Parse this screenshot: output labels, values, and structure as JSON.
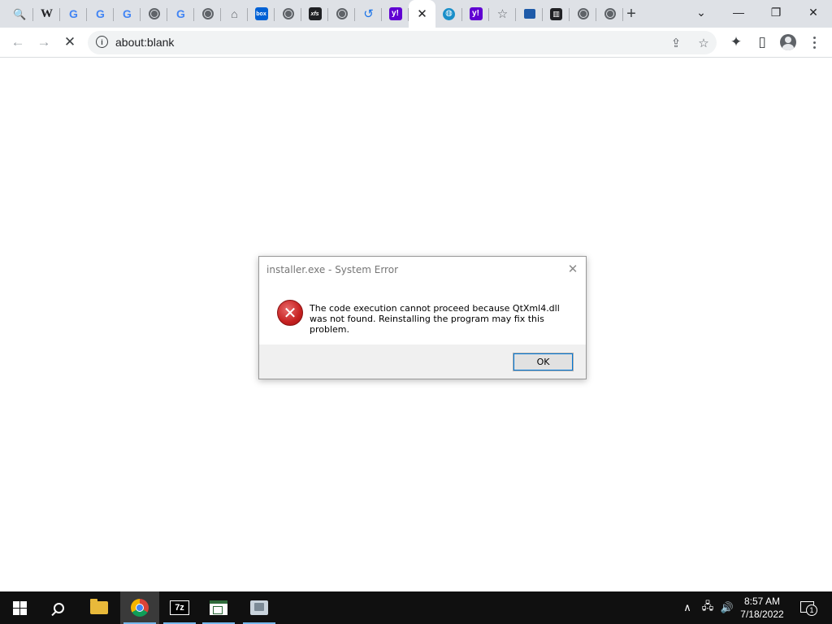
{
  "browser": {
    "tabs": [
      {
        "icon": "search-icon",
        "glyph": "🔍"
      },
      {
        "icon": "wikipedia-icon",
        "glyph": "W"
      },
      {
        "icon": "google-icon",
        "glyph": "G"
      },
      {
        "icon": "google-icon",
        "glyph": "G"
      },
      {
        "icon": "google-icon",
        "glyph": "G"
      },
      {
        "icon": "globe-icon",
        "glyph": ""
      },
      {
        "icon": "google-icon",
        "glyph": "G"
      },
      {
        "icon": "globe-icon",
        "glyph": ""
      },
      {
        "icon": "home-icon",
        "glyph": "⌂"
      },
      {
        "icon": "box-icon",
        "glyph": "box"
      },
      {
        "icon": "globe-icon",
        "glyph": ""
      },
      {
        "icon": "xfs-icon",
        "glyph": "xfs"
      },
      {
        "icon": "globe-icon",
        "glyph": ""
      },
      {
        "icon": "history-icon",
        "glyph": "↺"
      },
      {
        "icon": "yahoo-icon",
        "glyph": "y!"
      },
      {
        "icon": "close-icon",
        "glyph": "✕",
        "active": true
      },
      {
        "icon": "web-globe-icon",
        "glyph": "◍"
      },
      {
        "icon": "yahoo-icon",
        "glyph": "y!"
      },
      {
        "icon": "star-icon",
        "glyph": "☆"
      },
      {
        "icon": "blue-square-icon",
        "glyph": ""
      },
      {
        "icon": "bank-icon",
        "glyph": "▥"
      },
      {
        "icon": "globe-icon",
        "glyph": ""
      },
      {
        "icon": "globe-icon",
        "glyph": ""
      }
    ],
    "new_tab_glyph": "+",
    "window_controls": {
      "tab_search": "⌄",
      "minimize": "—",
      "restore": "❐",
      "close": "✕"
    },
    "address_bar": {
      "url": "about:blank",
      "info_glyph": "i"
    },
    "nav": {
      "back": "←",
      "forward": "→",
      "stop": "✕"
    },
    "toolbar_icons": {
      "share": "⇪",
      "bookmark": "☆",
      "extensions": "✦",
      "side_panel": "▯"
    }
  },
  "dialog": {
    "title": "installer.exe - System Error",
    "message": "The code execution cannot proceed because QtXml4.dll was not found. Reinstalling the program may fix this problem.",
    "ok_label": "OK",
    "close_glyph": "✕",
    "error_glyph": "✕"
  },
  "taskbar": {
    "clock_time": "8:57 AM",
    "clock_date": "7/18/2022",
    "sevenzip_label": "7z",
    "notification_count": "1",
    "tray": {
      "chevron": "∧",
      "network": "🖧",
      "volume": "🔊"
    }
  }
}
